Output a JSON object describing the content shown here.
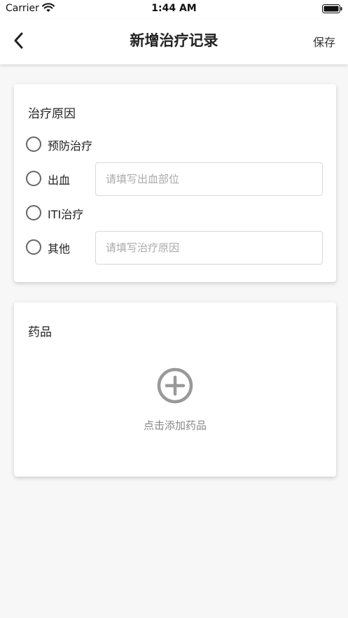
{
  "status_bar": {
    "carrier": "Carrier",
    "time": "1:44 AM"
  },
  "nav": {
    "title": "新增治疗记录",
    "save_label": "保存",
    "back_icon": "chevron-left-icon"
  },
  "reason_card": {
    "title": "治疗原因",
    "options": [
      {
        "label": "预防治疗",
        "selected": false
      },
      {
        "label": "出血",
        "selected": false,
        "input_placeholder": "请填写出血部位",
        "input_value": ""
      },
      {
        "label": "ITI治疗",
        "selected": false
      },
      {
        "label": "其他",
        "selected": false,
        "input_placeholder": "请填写治疗原因",
        "input_value": ""
      }
    ]
  },
  "medicine_card": {
    "title": "药品",
    "add_label": "点击添加药品",
    "add_icon": "plus-circle-icon"
  },
  "colors": {
    "background": "#f7f7f7",
    "card": "#ffffff",
    "radio_border": "#666666",
    "placeholder": "#aaaaaa",
    "icon_gray": "#999999"
  }
}
